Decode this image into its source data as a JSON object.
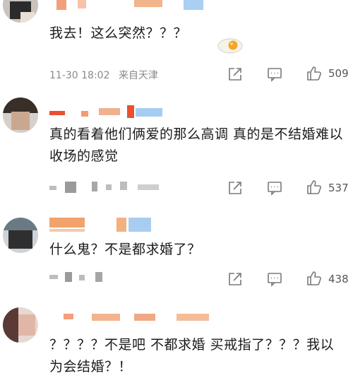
{
  "comments": [
    {
      "text": "我去！这么突然？？？",
      "timestamp": "11-30 18:02",
      "source": "来自天津",
      "likes": "509"
    },
    {
      "text": "真的看着他们俩爱的那么高调 真的是不结婚难以收场的感觉",
      "likes": "537"
    },
    {
      "text": "什么鬼？不是都求婚了？",
      "likes": "438"
    },
    {
      "text": "？？？？不是吧 不都求婚 买戒指了？？？我以为会结婚？！"
    }
  ],
  "icons": {
    "share": "share-icon",
    "comment": "comment-icon",
    "like": "thumbs-up-icon"
  },
  "colors": {
    "name_blur_orange": "#f2a36b",
    "name_blur_red": "#e8502f",
    "name_blur_blue": "#8fc3f0",
    "icon_gray": "#7a7a7a"
  }
}
